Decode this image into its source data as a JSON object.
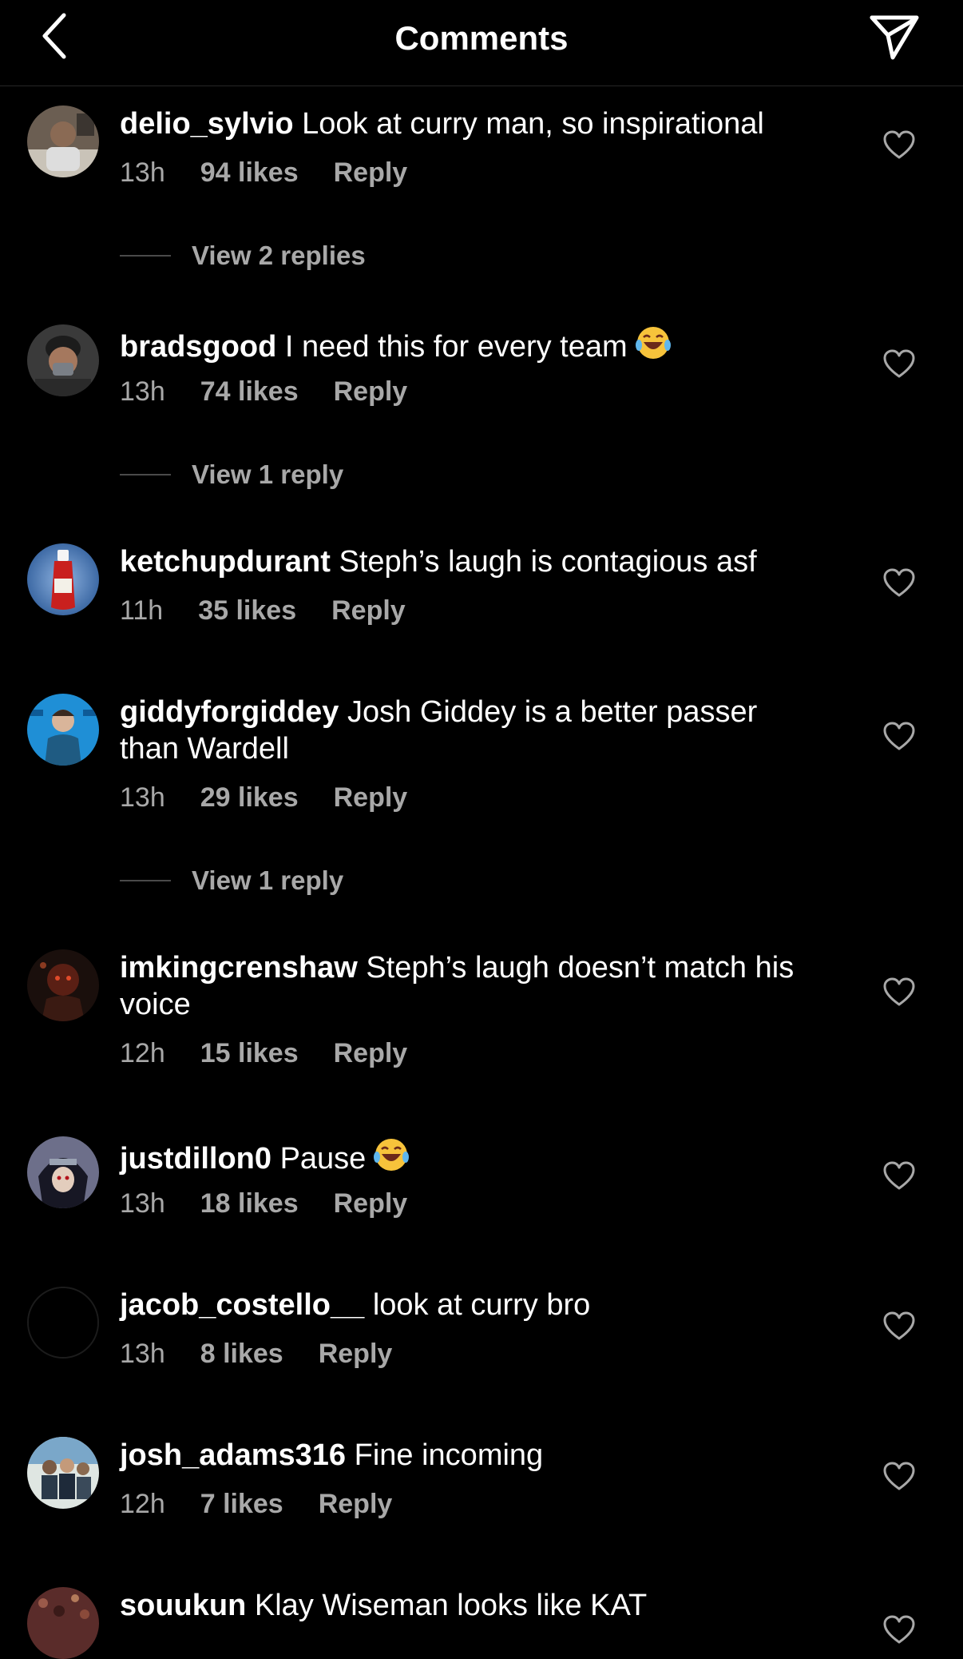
{
  "header": {
    "title": "Comments",
    "back_icon": "chevron-left-icon",
    "share_icon": "paper-plane-icon"
  },
  "comments": [
    {
      "username": "delio_sylvio",
      "text": "Look at curry man, so inspirational",
      "time": "13h",
      "likes": "94 likes",
      "reply": "Reply",
      "view_replies": "View 2 replies"
    },
    {
      "username": "bradsgood",
      "text": "I need this for every team",
      "time": "13h",
      "likes": "74 likes",
      "reply": "Reply",
      "view_replies": "View 1 reply"
    },
    {
      "username": "ketchupdurant",
      "text": "Steph’s laugh is contagious asf",
      "time": "11h",
      "likes": "35 likes",
      "reply": "Reply"
    },
    {
      "username": "giddyforgiddey",
      "text": "Josh Giddey is a better passer than Wardell",
      "time": "13h",
      "likes": "29 likes",
      "reply": "Reply",
      "view_replies": "View 1 reply"
    },
    {
      "username": "imkingcrenshaw",
      "text": "Steph’s laugh doesn’t match his voice",
      "time": "12h",
      "likes": "15 likes",
      "reply": "Reply"
    },
    {
      "username": "justdillon0",
      "text": "Pause",
      "time": "13h",
      "likes": "18 likes",
      "reply": "Reply"
    },
    {
      "username": "jacob_costello__",
      "text": "look at curry bro",
      "time": "13h",
      "likes": "8 likes",
      "reply": "Reply"
    },
    {
      "username": "josh_adams316",
      "text": "Fine incoming",
      "time": "12h",
      "likes": "7 likes",
      "reply": "Reply"
    },
    {
      "username": "souukun",
      "text": "Klay Wiseman looks like KAT"
    }
  ],
  "colors": {
    "background": "#000000",
    "text": "#ffffff",
    "secondary_text": "#a8a8a8",
    "divider": "#262626"
  }
}
